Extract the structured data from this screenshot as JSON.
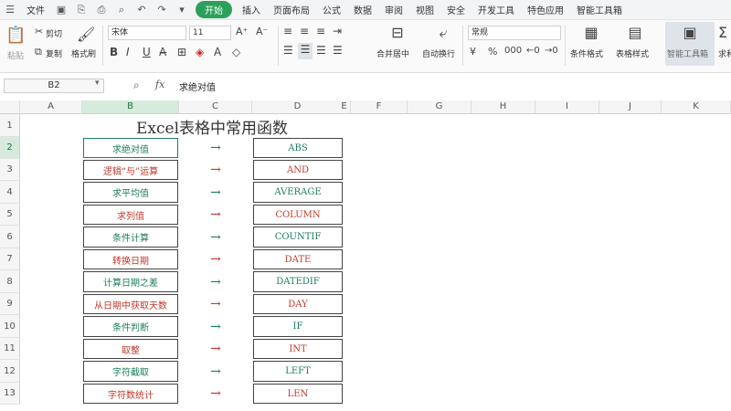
{
  "menubar": {
    "file": "文件",
    "tabs": [
      "开始",
      "插入",
      "页面布局",
      "公式",
      "数据",
      "审阅",
      "视图",
      "安全",
      "开发工具",
      "特色应用",
      "智能工具箱"
    ],
    "active_tab": "开始"
  },
  "ribbon": {
    "paste": "粘贴",
    "cut": "剪切",
    "copy": "复制",
    "format_painter": "格式刷",
    "font_name": "宋体",
    "font_size": "11",
    "merge_center": "合并居中",
    "wrap_text": "自动换行",
    "number_format": "常规",
    "conditional_format": "条件格式",
    "table_style": "表格样式",
    "smart_toolbox": "智能工具箱",
    "sum": "求和"
  },
  "formula_bar": {
    "name_box": "B2",
    "fx": "fx",
    "content": "求绝对值"
  },
  "sheet": {
    "columns": [
      "A",
      "B",
      "C",
      "D",
      "E",
      "F",
      "G",
      "H",
      "I",
      "J",
      "K"
    ],
    "rows": [
      "1",
      "2",
      "3",
      "4",
      "5",
      "6",
      "7",
      "8",
      "9",
      "10",
      "11",
      "12",
      "13"
    ],
    "title": "Excel表格中常用函数",
    "arrow": "→",
    "items": [
      {
        "desc": "求绝对值",
        "func": "ABS",
        "color": "green"
      },
      {
        "desc": "逻辑“与”运算",
        "func": "AND",
        "color": "red"
      },
      {
        "desc": "求平均值",
        "func": "AVERAGE",
        "color": "green"
      },
      {
        "desc": "求列值",
        "func": "COLUMN",
        "color": "red"
      },
      {
        "desc": "条件计算",
        "func": "COUNTIF",
        "color": "green"
      },
      {
        "desc": "转换日期",
        "func": "DATE",
        "color": "red"
      },
      {
        "desc": "计算日期之差",
        "func": "DATEDIF",
        "color": "green"
      },
      {
        "desc": "从日期中获取天数",
        "func": "DAY",
        "color": "red"
      },
      {
        "desc": "条件判断",
        "func": "IF",
        "color": "green"
      },
      {
        "desc": "取整",
        "func": "INT",
        "color": "red"
      },
      {
        "desc": "字符截取",
        "func": "LEFT",
        "color": "green"
      },
      {
        "desc": "字符数统计",
        "func": "LEN",
        "color": "red"
      }
    ]
  }
}
